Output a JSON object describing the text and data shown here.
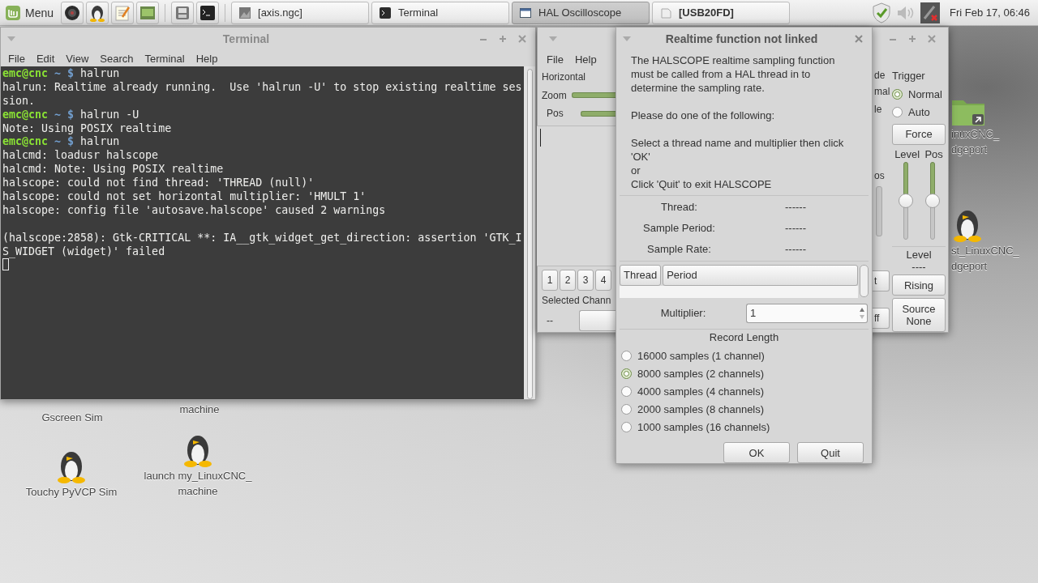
{
  "panel": {
    "menu": "Menu",
    "tasks": [
      {
        "kind": "image",
        "title": "[axis.ngc]",
        "selected": false,
        "urgent": false
      },
      {
        "kind": "terminal",
        "title": "Terminal",
        "selected": false,
        "urgent": false
      },
      {
        "kind": "window",
        "title": "HAL Oscilloscope",
        "selected": true,
        "urgent": false
      },
      {
        "kind": "drive",
        "title": "[USB20FD]",
        "selected": false,
        "urgent": true
      }
    ],
    "clock": "Fri Feb 17, 06:46"
  },
  "desktop_icons": [
    {
      "kind": "hidden",
      "label": "Gscreen Sim"
    },
    {
      "kind": "hidden",
      "label": "machine"
    },
    {
      "kind": "penguin",
      "label": "Touchy PyVCP Sim"
    },
    {
      "kind": "penguin",
      "label": "launch my_LinuxCNC_ machine"
    },
    {
      "kind": "folder",
      "label": "inuxCNC_ dgeport"
    },
    {
      "kind": "penguin",
      "label": "st_LinuxCNC_ dgeport"
    }
  ],
  "terminal": {
    "title": "Terminal",
    "menu": [
      "File",
      "Edit",
      "View",
      "Search",
      "Terminal",
      "Help"
    ],
    "lines": [
      {
        "kind": "prompt",
        "user": "emc@cnc",
        "path": "~ $",
        "command": "halrun"
      },
      {
        "kind": "output",
        "text": "halrun: Realtime already running.  Use 'halrun -U' to stop existing realtime ses"
      },
      {
        "kind": "output",
        "text": "sion."
      },
      {
        "kind": "prompt",
        "user": "emc@cnc",
        "path": "~ $",
        "command": "halrun -U"
      },
      {
        "kind": "output",
        "text": "Note: Using POSIX realtime"
      },
      {
        "kind": "prompt",
        "user": "emc@cnc",
        "path": "~ $",
        "command": "halrun"
      },
      {
        "kind": "output",
        "text": "halcmd: loadusr halscope"
      },
      {
        "kind": "output",
        "text": "halcmd: Note: Using POSIX realtime"
      },
      {
        "kind": "output",
        "text": "halscope: could not find thread: 'THREAD (null)'"
      },
      {
        "kind": "output",
        "text": "halscope: could not set horizontal multiplier: 'HMULT 1'"
      },
      {
        "kind": "output",
        "text": "halscope: config file 'autosave.halscope' caused 2 warnings"
      },
      {
        "kind": "blank"
      },
      {
        "kind": "output",
        "text": "(halscope:2858): Gtk-CRITICAL **: IA__gtk_widget_get_direction: assertion 'GTK_I"
      },
      {
        "kind": "output",
        "text": "S_WIDGET (widget)' failed"
      },
      {
        "kind": "cursor"
      }
    ]
  },
  "scope": {
    "menu": [
      "File",
      "Help"
    ],
    "horizontal": "Horizontal",
    "zoom": {
      "label": "Zoom",
      "level": 1
    },
    "pos": {
      "label": "Pos",
      "level": 1
    },
    "channels": [
      "1",
      "2",
      "3",
      "4"
    ],
    "selected_channel": "Selected Chann",
    "channel_value": "--",
    "fragments": [
      "de",
      "mal",
      "le",
      "os"
    ],
    "fragment_buttons": [
      "t",
      "ff"
    ],
    "trigger": {
      "title": "Trigger",
      "modes": [
        {
          "label": "Normal",
          "selected": true
        },
        {
          "label": "Auto",
          "selected": false
        }
      ],
      "force": "Force",
      "sliders": [
        {
          "label": "Level",
          "level": 0.5
        },
        {
          "label": "Pos",
          "level": 0.5
        }
      ],
      "level_label": "Level",
      "level_value": "----",
      "edge": "Rising",
      "source": "Source None"
    }
  },
  "dialog": {
    "title": "Realtime function not linked",
    "paragraphs": [
      "The HALSCOPE realtime sampling function\nmust be called from a HAL thread in to\ndetermine the sampling rate.",
      "Please do one of the following:",
      "Select a thread name and multiplier then click 'OK'\nor\nClick 'Quit' to exit HALSCOPE"
    ],
    "info": [
      {
        "label": "Thread:",
        "value": "------"
      },
      {
        "label": "Sample Period:",
        "value": "------"
      },
      {
        "label": "Sample Rate:",
        "value": "------"
      }
    ],
    "list_columns": [
      "Thread",
      "Period"
    ],
    "multiplier": {
      "label": "Multiplier:",
      "value": "1"
    },
    "record_length": {
      "title": "Record Length",
      "options": [
        {
          "label": "16000 samples (1 channel)",
          "selected": false
        },
        {
          "label": "8000 samples (2 channels)",
          "selected": true
        },
        {
          "label": "4000 samples (4 channels)",
          "selected": false
        },
        {
          "label": "2000 samples (8 channels)",
          "selected": false
        },
        {
          "label": "1000 samples (16 channels)",
          "selected": false
        }
      ]
    },
    "buttons": [
      "OK",
      "Quit"
    ]
  }
}
